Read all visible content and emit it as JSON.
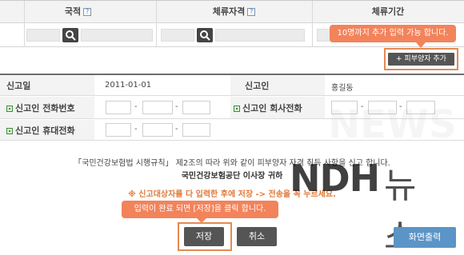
{
  "top_table": {
    "columns": [
      {
        "label": "국적",
        "help": "?"
      },
      {
        "label": "체류자격",
        "help": "?"
      },
      {
        "label": "체류기간",
        "help": ""
      }
    ]
  },
  "tooltip_top": "10명까지 추가 입력 가능 합니다.",
  "add_dependent_label": "+ 피부양자 추가",
  "report_info": {
    "date_label": "신고일",
    "date_value": "2011-01-01",
    "reporter_label": "신고인",
    "reporter_value": "홍길동",
    "phone_label": "신고인 전화번호",
    "company_phone_label": "신고인 회사전화",
    "mobile_label": "신고인 휴대전화",
    "dash": "-"
  },
  "notice": {
    "law_text": "「국민건강보험법 시행규칙」 제2조의 따라 위와 같이 피부양자 자격 취득 사항을 신고 합니다.",
    "recipient": "국민건강보험공단 이사장 귀하",
    "warning": "※ 신고대상자를 다 입력한 후에 저장 -> 전송을 꼭 누르세요."
  },
  "tooltip_bottom": "입력이 완료 되면 [저장]을 클릭 합니다.",
  "buttons": {
    "save": "저장",
    "cancel": "취소",
    "print": "화면출력"
  },
  "watermark": {
    "ndh": "NDH",
    "news": "뉴스"
  },
  "colors": {
    "accent_orange": "#f2835b",
    "dark_button": "#555555",
    "print_button": "#5b94c6"
  }
}
